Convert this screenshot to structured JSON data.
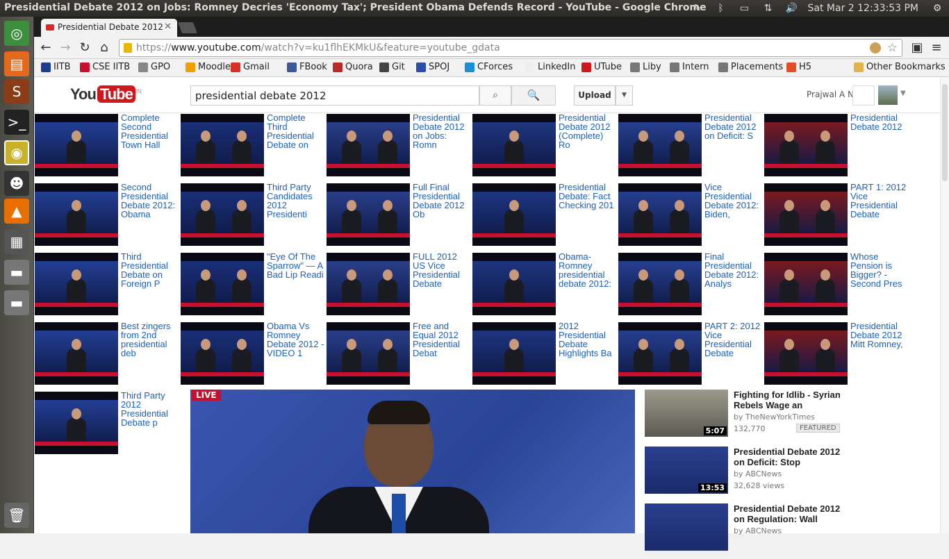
{
  "os": {
    "window_title": "Presidential Debate 2012 on Jobs: Romney Decries 'Economy Tax'; President Obama Defends Record - YouTube - Google Chrome",
    "clock": "Sat Mar  2  12:33:53 PM"
  },
  "browser": {
    "tab_title": "Presidential Debate 2012",
    "url_scheme": "https://",
    "url_host": "www.youtube.com",
    "url_path": "/watch?v=ku1flhEKMkU&feature=youtube_gdata",
    "bookmarks": [
      {
        "label": "IITB",
        "color": "#1b3f8c"
      },
      {
        "label": "CSE IITB",
        "color": "#c8102e"
      },
      {
        "label": "GPO",
        "color": "#888888"
      },
      {
        "label": "Moodle",
        "color": "#f0a000"
      },
      {
        "label": "Gmail",
        "color": "#d93025"
      },
      {
        "label": "FBook",
        "color": "#3b5998"
      },
      {
        "label": "Quora",
        "color": "#b92b27"
      },
      {
        "label": "Git",
        "color": "#444444"
      },
      {
        "label": "SPOJ",
        "color": "#2a4fa8"
      },
      {
        "label": "CForces",
        "color": "#1a8fd6"
      },
      {
        "label": "LinkedIn",
        "color": "#eeeeee"
      },
      {
        "label": "UTube",
        "color": "#cc181e"
      },
      {
        "label": "Liby",
        "color": "#777777"
      },
      {
        "label": "Intern",
        "color": "#777777"
      },
      {
        "label": "Placements",
        "color": "#777777"
      },
      {
        "label": "H5",
        "color": "#e44d26"
      }
    ],
    "other_bookmarks": "Other Bookmarks"
  },
  "youtube": {
    "logo_you": "You",
    "logo_tube": "Tube",
    "logo_region": "IN",
    "search_value": "presidential debate 2012",
    "upload_label": "Upload",
    "user_name": "Prajwal A N",
    "grid": [
      "Complete Second Presidential Town Hall",
      "Complete Third Presidential Debate on",
      "Presidential Debate 2012 on Jobs: Romn",
      "Presidential Debate 2012 (Complete) Ro",
      "Presidential Debate 2012 on Deficit: S",
      "Presidential Debate 2012",
      "Second Presidential Debate 2012: Obama",
      "Third Party Candidates 2012 Presidenti",
      "Full Final Presidential Debate 2012 Ob",
      "Presidential Debate: Fact Checking 201",
      "Vice Presidential Debate 2012: Biden,",
      "PART 1: 2012 Vice Presidential Debate",
      "Third Presidential Debate on Foreign P",
      "\"Eye Of The Sparrow\" — A Bad Lip Readi",
      "FULL 2012 US Vice Presidential Debate",
      "Obama-Romney presidential debate 2012:",
      "Final Presidential Debate 2012: Analys",
      "Whose Pension is Bigger? - Second Pres",
      "Best zingers from 2nd presidential deb",
      "Obama Vs Romney Debate 2012 - VIDEO 1",
      "Free and Equal 2012 Presidential Debat",
      "2012 Presidential Debate Highlights Ba",
      "PART 2: 2012 Vice Presidential Debate",
      "Presidential Debate 2012 Mitt Romney,",
      "Third Party 2012 Presidential Debate p"
    ],
    "player_badge": "LIVE",
    "sidebar": [
      {
        "title": "Fighting for Idlib - Syrian Rebels Wage an",
        "by": "by TheNewYorkTimes",
        "views": "132,770",
        "duration": "5:07",
        "badge": "FEATURED"
      },
      {
        "title": "Presidential Debate 2012 on Deficit: Stop",
        "by": "by ABCNews",
        "views": "32,628 views",
        "duration": "13:53",
        "badge": ""
      },
      {
        "title": "Presidential Debate 2012 on Regulation: Wall",
        "by": "by ABCNews",
        "views": "",
        "duration": "",
        "badge": ""
      }
    ]
  }
}
